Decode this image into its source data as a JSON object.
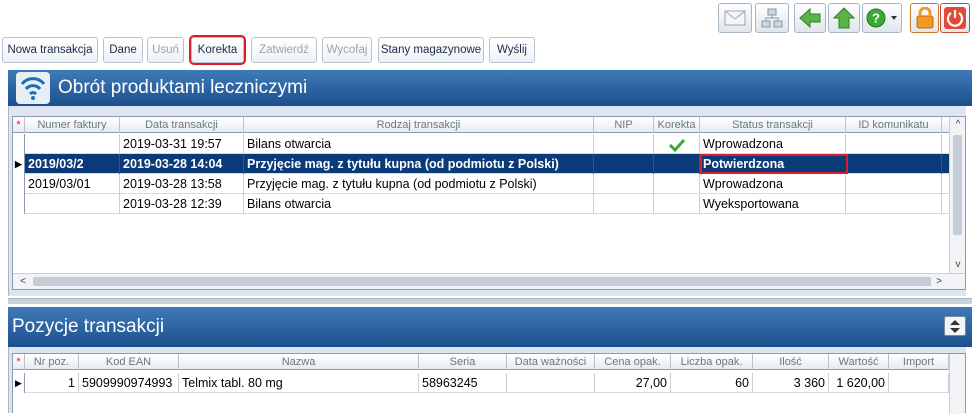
{
  "toolbar": {
    "buttons": [
      "Nowa transakcja",
      "Dane",
      "Usuń",
      "Korekta",
      "Zatwierdź",
      "Wycofaj",
      "Stany magazynowe",
      "Wyślij"
    ]
  },
  "icons": [
    "mail-icon",
    "network-icon",
    "back-arrow-icon",
    "up-arrow-icon",
    "help-icon",
    "lock-icon",
    "power-icon"
  ],
  "colors": {
    "header_blue": "#1b4f8c",
    "selected_row": "#0b3a78",
    "highlight_red": "#d81e2a",
    "check_green": "#3aa935"
  },
  "transactions": {
    "title": "Obrót produktami leczniczymi",
    "columns": [
      "Numer faktury",
      "Data transakcji",
      "Rodzaj transakcji",
      "NIP",
      "Korekta",
      "Status transakcji",
      "ID komunikatu"
    ],
    "rows": [
      {
        "numer": "",
        "data": "2019-03-31 19:57",
        "rodzaj": "Bilans otwarcia",
        "nip": "",
        "korekta": "check",
        "status": "Wprowadzona",
        "id": ""
      },
      {
        "numer": "2019/03/2",
        "data": "2019-03-28 14:04",
        "rodzaj": "Przyjęcie mag. z tytułu kupna (od podmiotu z Polski)",
        "nip": "",
        "korekta": "",
        "status": "Potwierdzona",
        "id": ""
      },
      {
        "numer": "2019/03/01",
        "data": "2019-03-28 13:58",
        "rodzaj": "Przyjęcie mag. z tytułu kupna (od podmiotu z Polski)",
        "nip": "",
        "korekta": "",
        "status": "Wprowadzona",
        "id": ""
      },
      {
        "numer": "",
        "data": "2019-03-28 12:39",
        "rodzaj": "Bilans otwarcia",
        "nip": "",
        "korekta": "",
        "status": "Wyeksportowana",
        "id": ""
      }
    ]
  },
  "positions": {
    "title": "Pozycje transakcji",
    "columns": [
      "Nr poz.",
      "Kod EAN",
      "Nazwa",
      "Seria",
      "Data ważności",
      "Cena opak.",
      "Liczba opak.",
      "Ilość",
      "Wartość",
      "Import"
    ],
    "rows": [
      {
        "nr": "1",
        "ean": "5909990974993",
        "nazwa": "Telmix tabl. 80 mg",
        "seria": "58963245",
        "data_waz": "",
        "cena": "27,00",
        "liczba": "60",
        "ilosc": "3 360",
        "wartosc": "1 620,00",
        "import": ""
      }
    ]
  }
}
